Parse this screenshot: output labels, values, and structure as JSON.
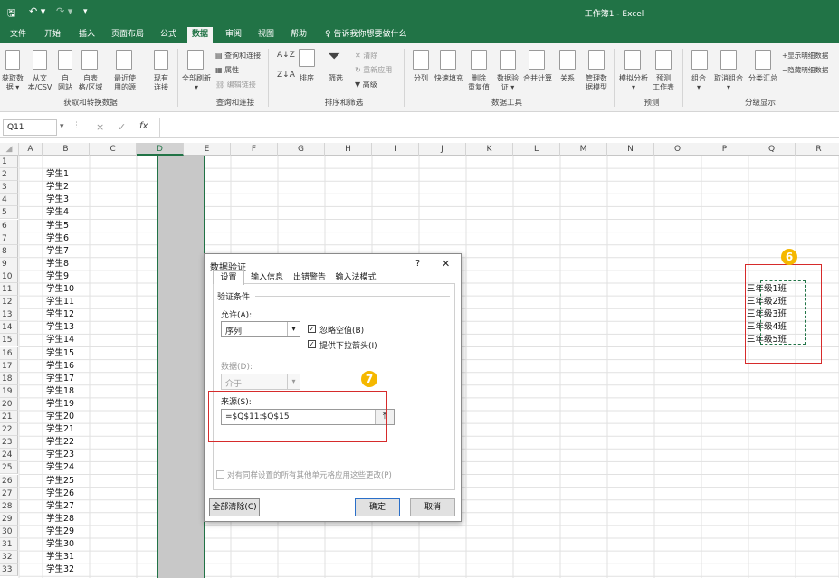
{
  "window": {
    "title": "工作簿1  -  Excel"
  },
  "tabs": [
    "文件",
    "开始",
    "插入",
    "页面布局",
    "公式",
    "数据",
    "审阅",
    "视图",
    "帮助"
  ],
  "tell_me": "告诉我你想要做什么",
  "ribbon": {
    "get_transform": {
      "label": "获取和转换数据",
      "items": [
        {
          "l1": "获取数",
          "l2": "据 ▾"
        },
        {
          "l1": "从文",
          "l2": "本/CSV"
        },
        {
          "l1": "自",
          "l2": "网站"
        },
        {
          "l1": "自表",
          "l2": "格/区域"
        },
        {
          "l1": "最近使",
          "l2": "用的源"
        },
        {
          "l1": "现有",
          "l2": "连接"
        }
      ]
    },
    "queries": {
      "label": "查询和连接",
      "refresh_l1": "全部刷新",
      "refresh_l2": "▾",
      "queries": "查询和连接",
      "properties": "属性",
      "edit_links": "编辑链接"
    },
    "sort_filter": {
      "label": "排序和筛选",
      "sort": "排序",
      "filter": "筛选",
      "clear": "清除",
      "reapply": "重新应用",
      "advanced": "高级"
    },
    "data_tools": {
      "label": "数据工具",
      "items": [
        {
          "l1": "分列",
          "l2": ""
        },
        {
          "l1": "快速填充",
          "l2": ""
        },
        {
          "l1": "删除",
          "l2": "重复值"
        },
        {
          "l1": "数据验",
          "l2": "证 ▾"
        },
        {
          "l1": "合并计算",
          "l2": ""
        },
        {
          "l1": "关系",
          "l2": ""
        },
        {
          "l1": "管理数",
          "l2": "据模型"
        }
      ]
    },
    "forecast": {
      "label": "预测",
      "whatif_l1": "模拟分析",
      "whatif_l2": "▾",
      "sheet_l1": "预测",
      "sheet_l2": "工作表"
    },
    "outline": {
      "label": "分级显示",
      "group_l1": "组合",
      "group_l2": "▾",
      "ungroup_l1": "取消组合",
      "ungroup_l2": "▾",
      "subtotal": "分类汇总",
      "show": "显示明细数据",
      "hide": "隐藏明细数据"
    }
  },
  "formula_bar": {
    "name_box": "Q11",
    "cancel": "×",
    "enter": "✓",
    "fx": "fx",
    "value": ""
  },
  "columns": [
    "A",
    "B",
    "C",
    "D",
    "E",
    "F",
    "G",
    "H",
    "I",
    "J",
    "K",
    "L",
    "M",
    "N",
    "O",
    "P",
    "Q",
    "R"
  ],
  "rows": [
    "1",
    "2",
    "3",
    "4",
    "5",
    "6",
    "7",
    "8",
    "9",
    "10",
    "11",
    "12",
    "13",
    "14",
    "15",
    "16",
    "17",
    "18",
    "19",
    "20",
    "21",
    "22",
    "23",
    "24",
    "25",
    "26",
    "27",
    "28",
    "29",
    "30",
    "31",
    "32",
    "33"
  ],
  "column_b": [
    "",
    "学生1",
    "学生2",
    "学生3",
    "学生4",
    "学生5",
    "学生6",
    "学生7",
    "学生8",
    "学生9",
    "学生10",
    "学生11",
    "学生12",
    "学生13",
    "学生14",
    "学生15",
    "学生16",
    "学生17",
    "学生18",
    "学生19",
    "学生20",
    "学生21",
    "学生22",
    "学生23",
    "学生24",
    "学生25",
    "学生26",
    "学生27",
    "学生28",
    "学生29",
    "学生30",
    "学生31",
    "学生32"
  ],
  "column_q": [
    "三年级1班",
    "三年级2班",
    "三年级3班",
    "三年级4班",
    "三年级5班"
  ],
  "annotations": {
    "six": "6",
    "seven": "7"
  },
  "dialog": {
    "title": "数据验证",
    "help": "?",
    "close": "✕",
    "tabs": [
      "设置",
      "输入信息",
      "出错警告",
      "输入法模式"
    ],
    "section": "验证条件",
    "allow_label": "允许(A):",
    "allow_value": "序列",
    "ignore_blank": "忽略空值(B)",
    "dropdown": "提供下拉箭头(I)",
    "data_label": "数据(D):",
    "data_value": "介于",
    "source_label": "来源(S):",
    "source_value": "=$Q$11:$Q$15",
    "apply_all": "对有同样设置的所有其他单元格应用这些更改(P)",
    "clear_all": "全部清除(C)",
    "ok": "确定",
    "cancel": "取消"
  },
  "colors": {
    "excel_green": "#217346",
    "annotation_red": "#d62b2b",
    "badge_yellow": "#f5b800",
    "selected_col": "#c8c8c8"
  }
}
